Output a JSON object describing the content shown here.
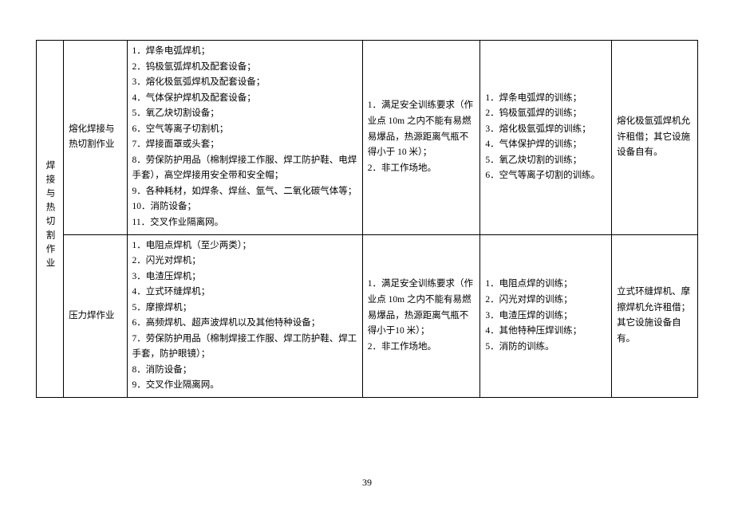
{
  "page_number": "39",
  "table": {
    "col1_label": "焊接与热切割作业",
    "rows": [
      {
        "col2": "熔化焊接与热切割作业",
        "col3": "1．焊条电弧焊机；\n2．钨极氩弧焊机及配套设备；\n3．熔化极氩弧焊机及配套设备；\n4．气体保护焊机及配套设备；\n5．氧乙炔切割设备；\n6．空气等离子切割机；\n7．焊接面罩或头套；\n8．劳保防护用品（棉制焊接工作服、焊工防护鞋、电焊手套），高空焊接用安全带和安全帽；\n9．各种耗材，如焊条、焊丝、氩气、二氧化碳气体等；\n10．消防设备；\n11．交叉作业隔离网。",
        "col4": "1．满足安全训练要求（作业点 10m 之内不能有易燃易爆品，热源距离气瓶不得小于 10 米）；\n2．非工作场地。",
        "col5": "1．焊条电弧焊的训练；\n2．钨极氩弧焊的训练；\n3．熔化极氩弧焊的训练；\n4．气体保护焊的训练；\n5．氧乙炔切割的训练；\n6．空气等离子切割的训练。",
        "col6": "熔化极氩弧焊机允许租借；其它设施设备自有。"
      },
      {
        "col2": "压力焊作业",
        "col3": "1．电阻点焊机（至少两类）；\n2．闪光对焊机；\n3．电渣压焊机；\n4．立式环缝焊机；\n5．摩擦焊机；\n6．高频焊机、超声波焊机以及其他特种设备；\n7．劳保防护用品（棉制焊接工作服、焊工防护鞋、焊工手套，防护眼镜）；\n8．消防设备；\n9．交叉作业隔离网。",
        "col4": "1．满足安全训练要求（作业点 10m 之内不能有易燃易爆品，热源距离气瓶不得小于10 米）；\n2．非工作场地。",
        "col5": "1．电阻点焊的训练；\n2．闪光对焊的训练；\n3．电渣压焊的训练；\n4．其他特种压焊训练；\n5．消防的训练。",
        "col6": "立式环缝焊机、摩擦焊机允许租借；其它设施设备自有。"
      }
    ]
  }
}
